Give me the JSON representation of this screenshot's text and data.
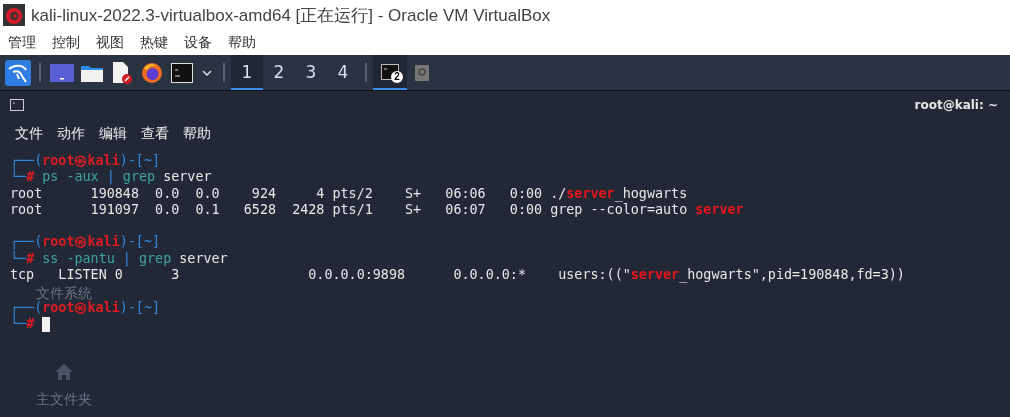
{
  "window": {
    "title": "kali-linux-2022.3-virtualbox-amd64 [正在运行] - Oracle VM VirtualBox"
  },
  "menu": [
    "管理",
    "控制",
    "视图",
    "热键",
    "设备",
    "帮助"
  ],
  "panel": {
    "workspaces": [
      {
        "label": "1",
        "selected": true
      },
      {
        "label": "2",
        "selected": false
      },
      {
        "label": "3",
        "selected": false
      },
      {
        "label": "4",
        "selected": false
      }
    ],
    "tasks": [
      {
        "badge": "2",
        "selected": true
      }
    ]
  },
  "terminal": {
    "title": "root@kali: ~",
    "menu": [
      "文件",
      "动作",
      "编辑",
      "查看",
      "帮助"
    ],
    "lines": [
      {
        "kind": "prompt",
        "text": "┌──(**root㉿kali**)-[~]"
      },
      {
        "kind": "command",
        "marker": "└─**#**",
        "tokens": [
          {
            "kind": "program",
            "text": "ps -aux"
          },
          {
            "kind": "pipe",
            "text": "|"
          },
          {
            "kind": "program",
            "text": "grep"
          },
          {
            "kind": "arg",
            "text": "server"
          }
        ]
      },
      {
        "kind": "output",
        "text": "root      190848  0.0  0.0    924     4 pts/2    S+   06:06   0:00 ./**server**_hogwarts"
      },
      {
        "kind": "output",
        "text": "root      191097  0.0  0.1   6528  2428 pts/1    S+   06:07   0:00 grep --color=auto **server**"
      },
      {
        "kind": "blank"
      },
      {
        "kind": "prompt",
        "text": "┌──(**root㉿kali**)-[~]"
      },
      {
        "kind": "command",
        "marker": "└─**#**",
        "tokens": [
          {
            "kind": "program",
            "text": "ss -pantu"
          },
          {
            "kind": "pipe",
            "text": "|"
          },
          {
            "kind": "program",
            "text": "grep"
          },
          {
            "kind": "arg",
            "text": "server"
          }
        ]
      },
      {
        "kind": "output",
        "text": "tcp   LISTEN 0      3                0.0.0.0:9898      0.0.0.0:*    users:((\"**server**_hogwarts\",pid=190848,fd=3))"
      },
      {
        "kind": "blank"
      },
      {
        "kind": "prompt",
        "text": "┌──(**root㉿kali**)-[~]"
      },
      {
        "kind": "command",
        "marker": "└─**#**",
        "cursor": true
      }
    ]
  },
  "desktop_icons": [
    {
      "kind": "drive",
      "label": "文件系统"
    },
    {
      "kind": "home",
      "label": "主文件夹"
    }
  ]
}
